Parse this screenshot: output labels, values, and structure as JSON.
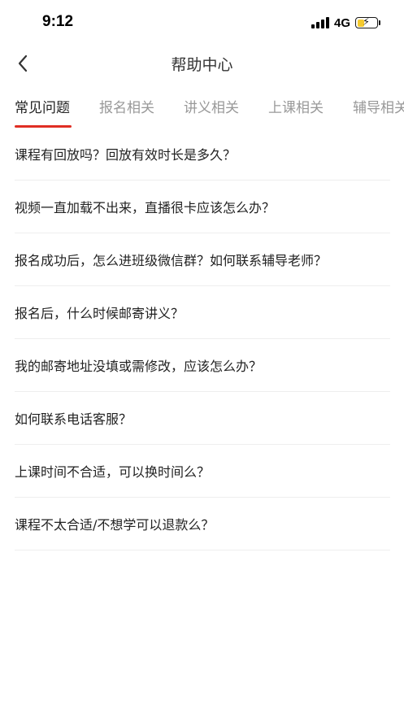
{
  "status_bar": {
    "time": "9:12",
    "network": "4G",
    "battery_level": 0.35,
    "battery_color": "#f5c518"
  },
  "nav": {
    "back_icon": "chevron-left-icon",
    "title": "帮助中心"
  },
  "tabs": [
    {
      "label": "常见问题",
      "active": true
    },
    {
      "label": "报名相关",
      "active": false
    },
    {
      "label": "讲义相关",
      "active": false
    },
    {
      "label": "上课相关",
      "active": false
    },
    {
      "label": "辅导相关",
      "active": false
    }
  ],
  "accent_color": "#e02e24",
  "faq": [
    "课程有回放吗？回放有效时长是多久？",
    "视频一直加载不出来，直播很卡应该怎么办？",
    "报名成功后，怎么进班级微信群？如何联系辅导老师？",
    "报名后，什么时候邮寄讲义？",
    "我的邮寄地址没填或需修改，应该怎么办？",
    "如何联系电话客服？",
    "上课时间不合适，可以换时间么？",
    "课程不太合适/不想学可以退款么？"
  ]
}
